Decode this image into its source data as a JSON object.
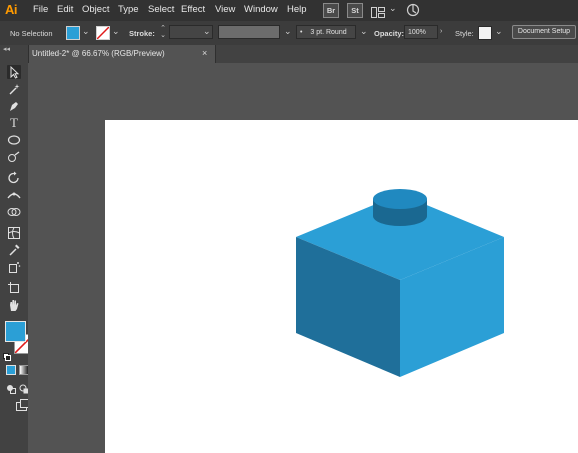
{
  "app": {
    "logo": "Ai"
  },
  "menu": {
    "items": [
      "File",
      "Edit",
      "Object",
      "Type",
      "Select",
      "Effect",
      "View",
      "Window",
      "Help"
    ],
    "bridge_badge": "Br",
    "stock_badge": "St"
  },
  "control_bar": {
    "selection_label": "No Selection",
    "fill_color": "#2b9fd6",
    "stroke_label": "Stroke:",
    "brush_value": "3 pt. Round",
    "opacity_label": "Opacity:",
    "opacity_value": "100%",
    "style_label": "Style:",
    "document_setup_label": "Document Setup"
  },
  "document_tab": {
    "title": "Untitled-2* @ 66.67% (RGB/Preview)",
    "close_glyph": "×"
  },
  "toolbar": {
    "collapse_glyph": "◂◂",
    "fill_swatch_color": "#2b9fd6"
  },
  "artwork": {
    "description_colors": {
      "top": "#2b9fd6",
      "left": "#1f6f9a",
      "right": "#2b9fd6",
      "stud_top": "#2089c0",
      "stud_side": "#1a6891"
    }
  }
}
